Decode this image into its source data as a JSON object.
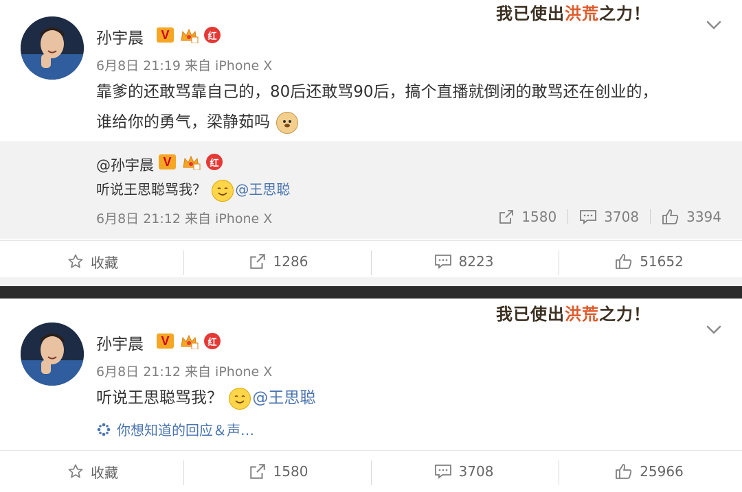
{
  "post1": {
    "username": "孙宇晨",
    "badges": {
      "v": "V",
      "red": "红"
    },
    "meta": "6月8日 21:19 来自 iPhone X",
    "text_line1": "靠爹的还敢骂靠自己的，80后还敢骂90后，搞个直播就倒闭的敢骂还在创业的，",
    "text_line2": "谁给你的勇气，梁静茹吗",
    "banner": {
      "part1": "我已使出",
      "part2": "洪荒",
      "part3": "之力！"
    },
    "quote": {
      "username": "@孙宇晨",
      "text": "听说王思聪骂我？",
      "mention": "@王思聪",
      "meta": "6月8日 21:12 来自 iPhone X",
      "repost_count": "1580",
      "comment_count": "3708",
      "like_count": "3394"
    },
    "actions": {
      "favorite": "收藏",
      "repost": "1286",
      "comment": "8223",
      "like": "51652"
    }
  },
  "post2": {
    "username": "孙宇晨",
    "badges": {
      "v": "V",
      "red": "红"
    },
    "meta": "6月8日 21:12 来自 iPhone X",
    "text": "听说王思聪骂我？",
    "mention": "@王思聪",
    "response_link": "你想知道的回应＆声…",
    "banner": {
      "part1": "我已使出",
      "part2": "洪荒",
      "part3": "之力！"
    },
    "actions": {
      "favorite": "收藏",
      "repost": "1580",
      "comment": "3708",
      "like": "25966"
    }
  },
  "colors": {
    "link": "#4a74b0",
    "meta_gray": "#7f7f7f",
    "quote_bg": "#f2f2f2",
    "divider_bar": "#2b2b2b"
  }
}
